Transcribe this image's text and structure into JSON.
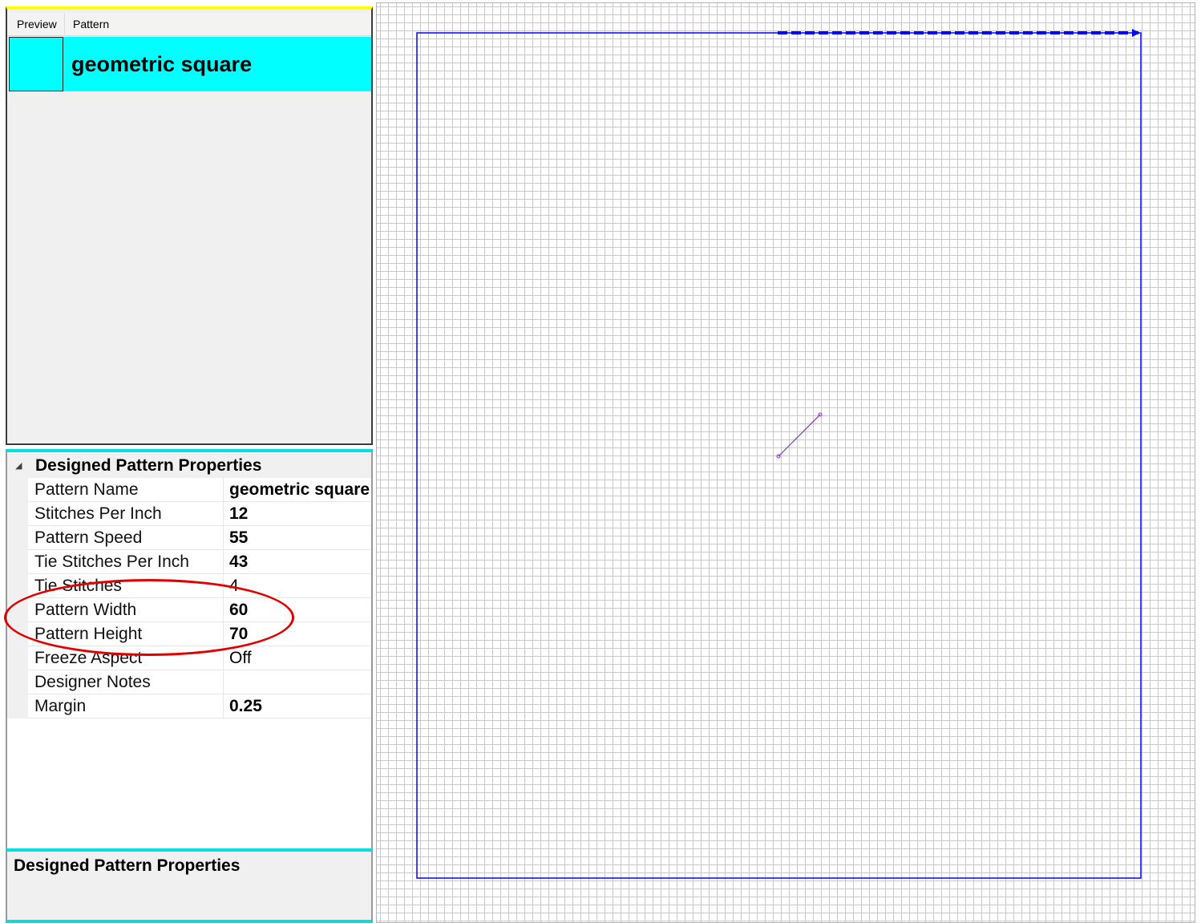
{
  "pattern_list": {
    "columns": {
      "preview": "Preview",
      "pattern": "Pattern"
    },
    "selected_item": {
      "name": "geometric square",
      "color": "#00ffff"
    }
  },
  "properties": {
    "category": "Designed Pattern Properties",
    "rows": [
      {
        "name": "Pattern Name",
        "value": "geometric square",
        "bold": true
      },
      {
        "name": "Stitches Per Inch",
        "value": "12",
        "bold": true
      },
      {
        "name": "Pattern Speed",
        "value": "55",
        "bold": true
      },
      {
        "name": "Tie Stitches Per Inch",
        "value": "43",
        "bold": true
      },
      {
        "name": "Tie Stitches",
        "value": "4",
        "bold": false
      },
      {
        "name": "Pattern Width",
        "value": "60",
        "bold": true
      },
      {
        "name": "Pattern Height",
        "value": "70",
        "bold": true
      },
      {
        "name": "Freeze Aspect",
        "value": "Off",
        "bold": false
      },
      {
        "name": "Designer Notes",
        "value": "",
        "bold": false
      },
      {
        "name": "Margin",
        "value": "0.25",
        "bold": true
      }
    ],
    "highlighted": [
      "Pattern Width",
      "Pattern Height"
    ]
  },
  "description": {
    "title": "Designed Pattern Properties"
  },
  "canvas": {
    "boundary_color": "#0000ff",
    "start_arrow_color": "#0000ff",
    "stitch_line_color": "#8a2be2",
    "highlight_color": "#e00000",
    "grid_color": "#c8c8c8"
  }
}
